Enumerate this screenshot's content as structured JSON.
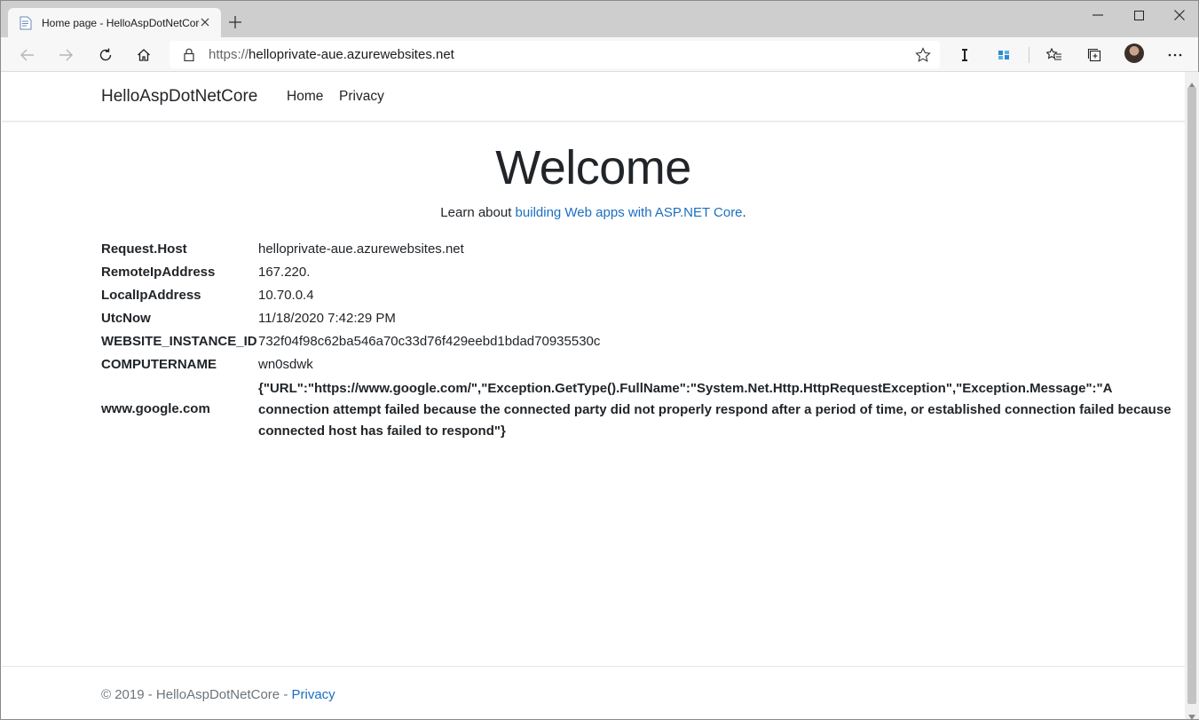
{
  "browser": {
    "tab_title": "Home page - HelloAspDotNetCore",
    "url_scheme": "https://",
    "url_host": "helloprivate-aue.azurewebsites.net"
  },
  "site": {
    "brand": "HelloAspDotNetCore",
    "nav": [
      "Home",
      "Privacy"
    ],
    "heading": "Welcome",
    "learn_prefix": "Learn about ",
    "learn_link": "building Web apps with ASP.NET Core",
    "learn_suffix": "."
  },
  "info": [
    {
      "key": "Request.Host",
      "value": "helloprivate-aue.azurewebsites.net"
    },
    {
      "key": "RemoteIpAddress",
      "value": "167.220."
    },
    {
      "key": "LocalIpAddress",
      "value": "10.70.0.4"
    },
    {
      "key": "UtcNow",
      "value": "11/18/2020 7:42:29 PM"
    },
    {
      "key": "WEBSITE_INSTANCE_ID",
      "value": "732f04f98c62ba546a70c33d76f429eebd1bdad70935530c"
    },
    {
      "key": "COMPUTERNAME",
      "value": "wn0sdwk"
    }
  ],
  "google": {
    "key": "www.google.com",
    "value": "{\"URL\":\"https://www.google.com/\",\"Exception.GetType().FullName\":\"System.Net.Http.HttpRequestException\",\"Exception.Message\":\"A connection attempt failed because the connected party did not properly respond after a period of time, or established connection failed because connected host has failed to respond\"}"
  },
  "footer": {
    "text": "© 2019 - HelloAspDotNetCore - ",
    "link": "Privacy"
  },
  "icons": {
    "back": "back-arrow-icon",
    "forward": "forward-arrow-icon",
    "refresh": "refresh-icon",
    "home": "home-icon",
    "lock": "lock-icon",
    "favorite": "star-icon",
    "reader": "immersive-reader-icon",
    "extension": "extension-icon",
    "favorites": "favorites-icon",
    "collections": "collections-icon",
    "profile": "avatar",
    "menu": "more-icon"
  },
  "colors": {
    "link": "#1b6ec2",
    "text": "#212529",
    "muted": "#6c757d",
    "titlebar": "#cecece",
    "toolbar": "#f7f7f7"
  }
}
